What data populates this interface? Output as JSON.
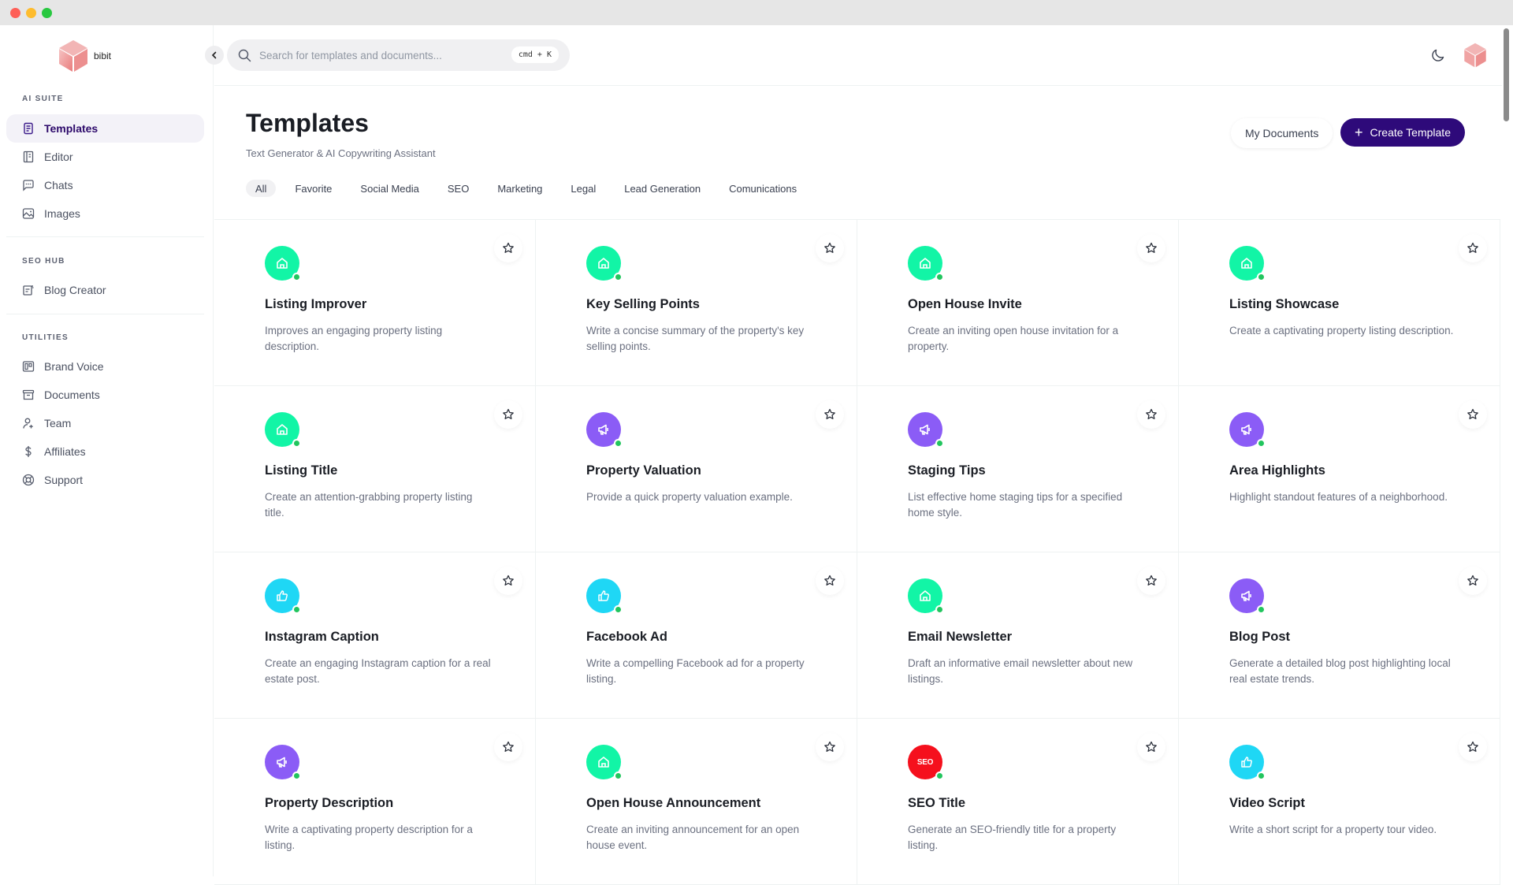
{
  "app": {
    "name": "bibit"
  },
  "colors": {
    "brand": "#2e0a7a",
    "home_icon": "#12f5a6",
    "megaphone_icon": "#8b5cf6",
    "thumbs_icon": "#1fd7f5",
    "seo_icon": "#f5101d",
    "status_online": "#22c55e"
  },
  "sidebar": {
    "sections": [
      {
        "label": "AI SUITE",
        "items": [
          {
            "label": "Templates",
            "icon": "document-icon",
            "active": true
          },
          {
            "label": "Editor",
            "icon": "notebook-icon"
          },
          {
            "label": "Chats",
            "icon": "chat-icon"
          },
          {
            "label": "Images",
            "icon": "image-icon"
          }
        ]
      },
      {
        "label": "SEO HUB",
        "items": [
          {
            "label": "Blog Creator",
            "icon": "blog-icon"
          }
        ]
      },
      {
        "label": "UTILITIES",
        "items": [
          {
            "label": "Brand Voice",
            "icon": "layout-icon"
          },
          {
            "label": "Documents",
            "icon": "archive-icon"
          },
          {
            "label": "Team",
            "icon": "user-plus-icon"
          },
          {
            "label": "Affiliates",
            "icon": "dollar-icon"
          },
          {
            "label": "Support",
            "icon": "lifebuoy-icon"
          }
        ]
      }
    ]
  },
  "topbar": {
    "search_placeholder": "Search for templates and documents...",
    "search_value": "",
    "shortcut": "cmd + K"
  },
  "header": {
    "title": "Templates",
    "subtitle": "Text Generator & AI Copywriting Assistant",
    "my_documents": "My Documents",
    "create_template": "Create Template",
    "tabs": [
      "All",
      "Favorite",
      "Social Media",
      "SEO",
      "Marketing",
      "Legal",
      "Lead Generation",
      "Comunications"
    ],
    "active_tab": "All"
  },
  "templates": [
    {
      "title": "Listing Improver",
      "desc": "Improves an engaging property listing description.",
      "icon": "home",
      "color": "#12f5a6"
    },
    {
      "title": "Key Selling Points",
      "desc": "Write a concise summary of the property's key selling points.",
      "icon": "home",
      "color": "#12f5a6"
    },
    {
      "title": "Open House Invite",
      "desc": "Create an inviting open house invitation for a property.",
      "icon": "home",
      "color": "#12f5a6"
    },
    {
      "title": "Listing Showcase",
      "desc": "Create a captivating property listing description.",
      "icon": "home",
      "color": "#12f5a6"
    },
    {
      "title": "Listing Title",
      "desc": "Create an attention-grabbing property listing title.",
      "icon": "home",
      "color": "#12f5a6"
    },
    {
      "title": "Property Valuation",
      "desc": "Provide a quick property valuation example.",
      "icon": "megaphone",
      "color": "#8b5cf6"
    },
    {
      "title": "Staging Tips",
      "desc": "List effective home staging tips for a specified home style.",
      "icon": "megaphone",
      "color": "#8b5cf6"
    },
    {
      "title": "Area Highlights",
      "desc": "Highlight standout features of a neighborhood.",
      "icon": "megaphone",
      "color": "#8b5cf6"
    },
    {
      "title": "Instagram Caption",
      "desc": "Create an engaging Instagram caption for a real estate post.",
      "icon": "thumbs-up",
      "color": "#1fd7f5"
    },
    {
      "title": "Facebook Ad",
      "desc": "Write a compelling Facebook ad for a property listing.",
      "icon": "thumbs-up",
      "color": "#1fd7f5"
    },
    {
      "title": "Email Newsletter",
      "desc": "Draft an informative email newsletter about new listings.",
      "icon": "home",
      "color": "#12f5a6"
    },
    {
      "title": "Blog Post",
      "desc": "Generate a detailed blog post highlighting local real estate trends.",
      "icon": "megaphone",
      "color": "#8b5cf6"
    },
    {
      "title": "Property Description",
      "desc": "Write a captivating property description for a listing.",
      "icon": "megaphone",
      "color": "#8b5cf6"
    },
    {
      "title": "Open House Announcement",
      "desc": "Create an inviting announcement for an open house event.",
      "icon": "home",
      "color": "#12f5a6"
    },
    {
      "title": "SEO Title",
      "desc": "Generate an SEO-friendly title for a property listing.",
      "icon": "seo",
      "icon_text": "SEO",
      "color": "#f5101d"
    },
    {
      "title": "Video Script",
      "desc": "Write a short script for a property tour video.",
      "icon": "thumbs-up",
      "color": "#1fd7f5"
    }
  ]
}
